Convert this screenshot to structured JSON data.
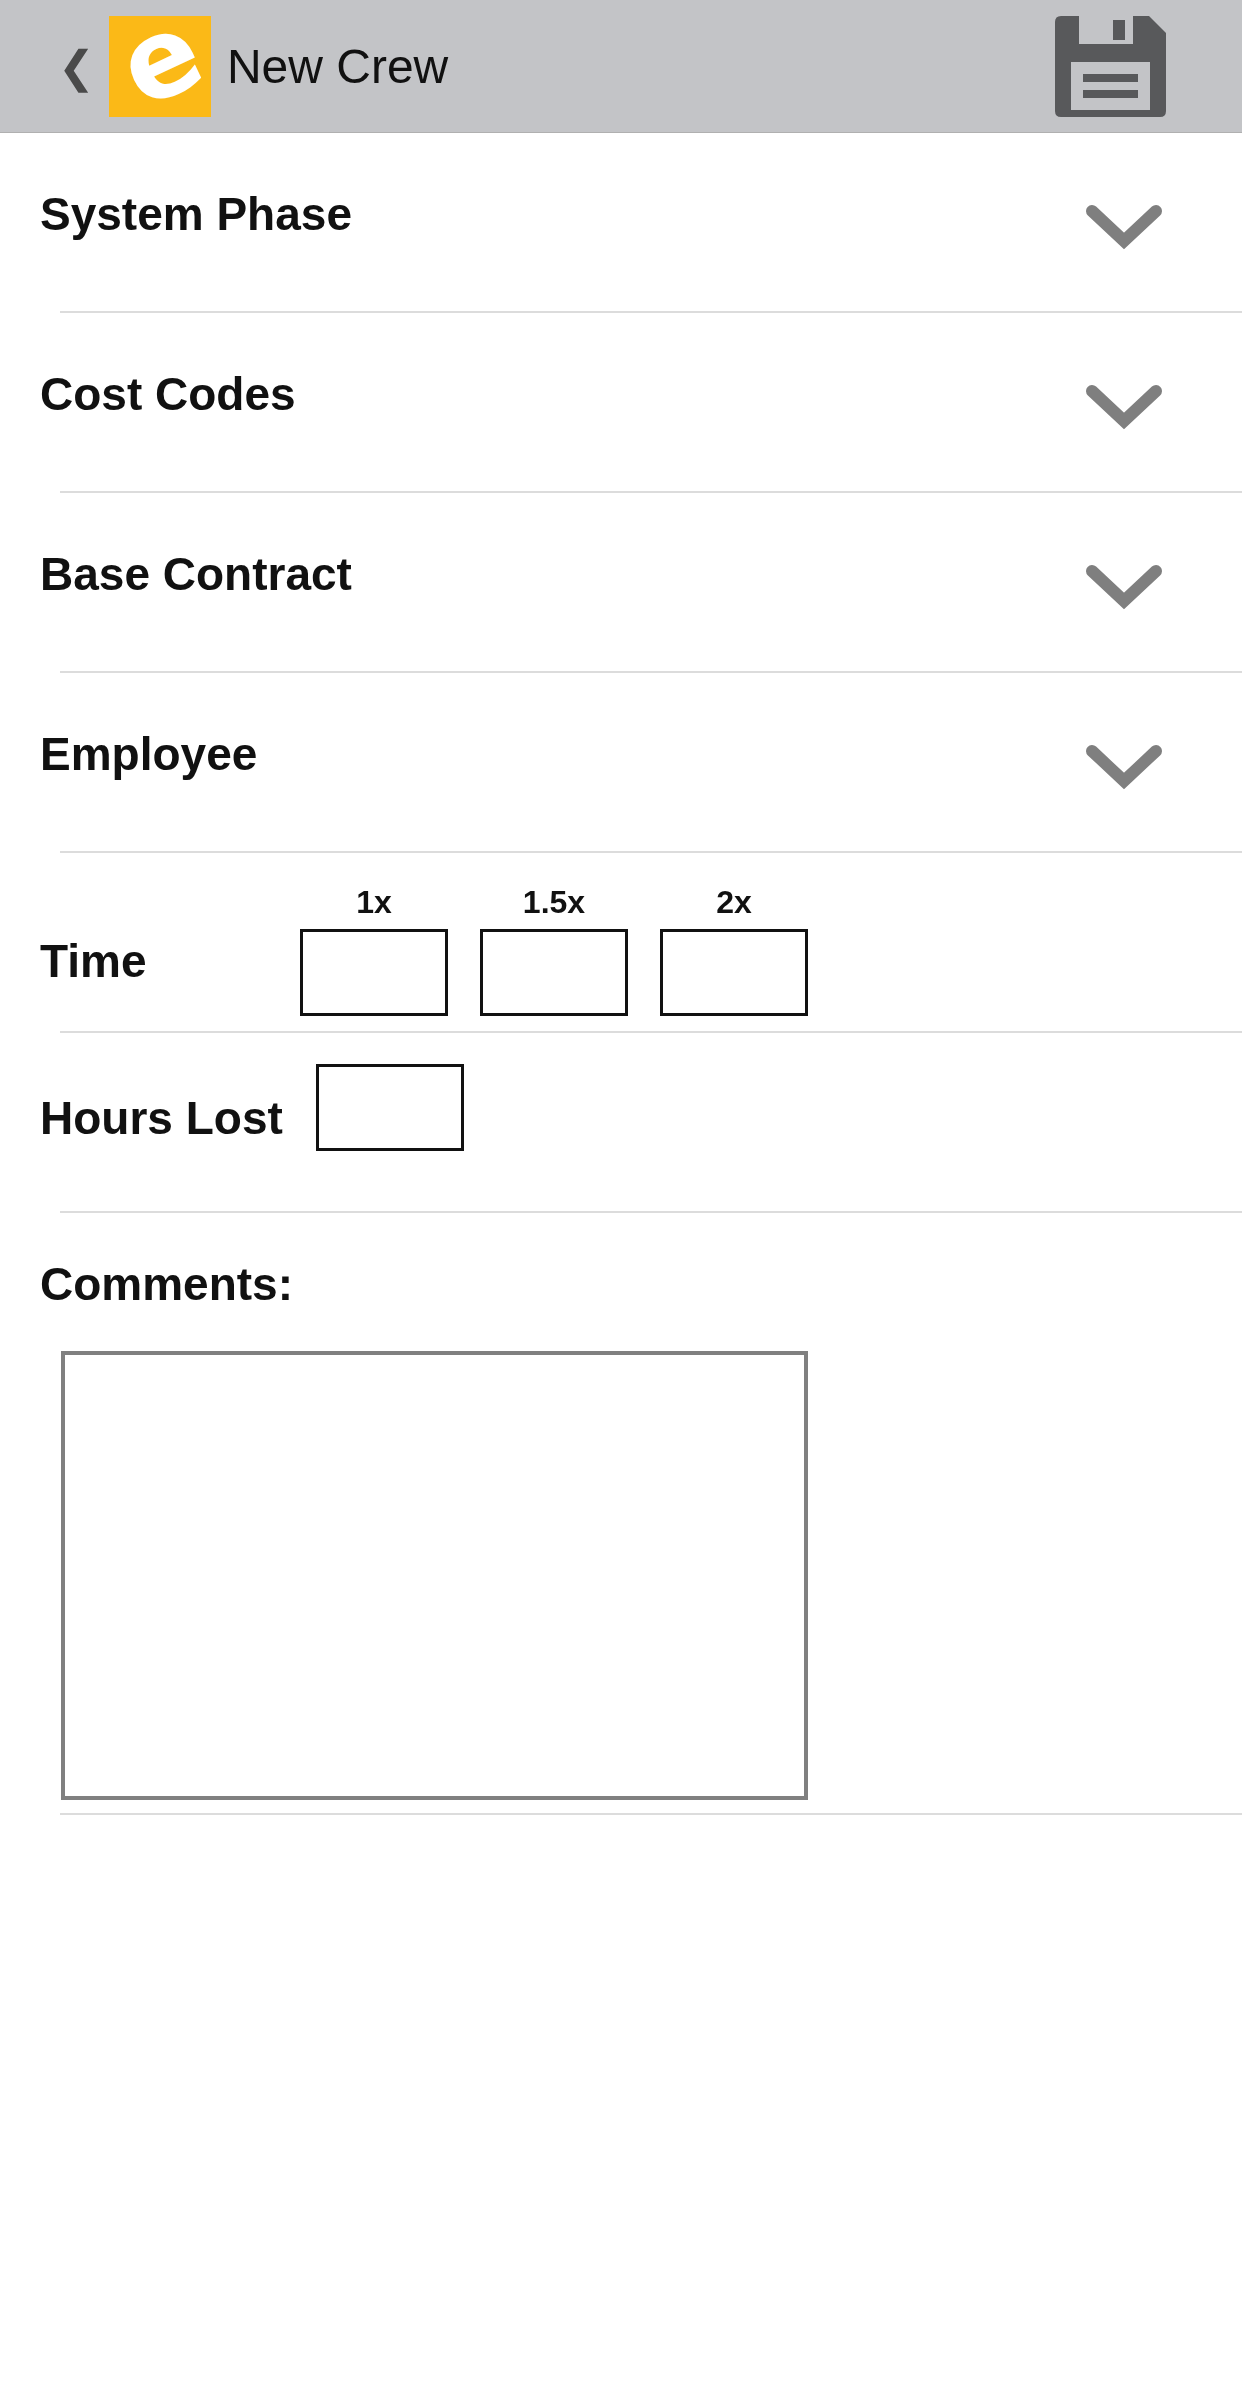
{
  "header": {
    "back": "❮",
    "logo": "e",
    "title": "New Crew"
  },
  "rows": [
    {
      "kind": "dropdown",
      "label": "System Phase"
    },
    {
      "kind": "dropdown",
      "label": "Cost Codes"
    },
    {
      "kind": "dropdown",
      "label": "Base Contract"
    },
    {
      "kind": "dropdown",
      "label": "Employee"
    },
    {
      "kind": "time",
      "label": "Time",
      "fields": [
        "1x",
        "1.5x",
        "2x"
      ]
    },
    {
      "kind": "hours",
      "label": "Hours Lost"
    }
  ],
  "comments": {
    "label": "Comments:"
  }
}
